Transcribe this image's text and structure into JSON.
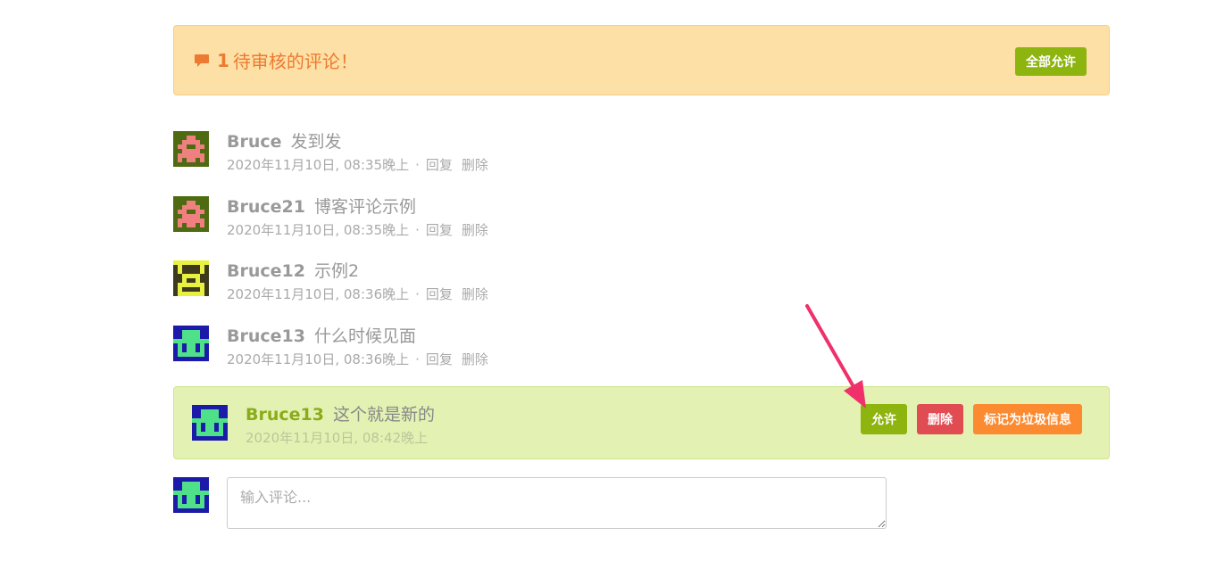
{
  "pending": {
    "count": "1",
    "title": "待审核的评论！",
    "approve_all_label": "全部允许"
  },
  "comments": [
    {
      "author": "Bruce",
      "text": "发到发",
      "date": "2020年11月10日, 08:35晚上",
      "sep": "·",
      "reply": "回复",
      "delete": "删除"
    },
    {
      "author": "Bruce21",
      "text": "博客评论示例",
      "date": "2020年11月10日, 08:35晚上",
      "sep": "·",
      "reply": "回复",
      "delete": "删除"
    },
    {
      "author": "Bruce12",
      "text": "示例2",
      "date": "2020年11月10日, 08:36晚上",
      "sep": "·",
      "reply": "回复",
      "delete": "删除"
    },
    {
      "author": "Bruce13",
      "text": "什么时候见面",
      "date": "2020年11月10日, 08:36晚上",
      "sep": "·",
      "reply": "回复",
      "delete": "删除"
    }
  ],
  "new_comment": {
    "author": "Bruce13",
    "text": "这个就是新的",
    "date": "2020年11月10日, 08:42晚上",
    "allow_label": "允许",
    "delete_label": "删除",
    "spam_label": "标记为垃圾信息"
  },
  "reply": {
    "placeholder": "输入评论..."
  },
  "colors": {
    "banner_bg": "#fde0a6",
    "banner_text": "#ec7a30",
    "approve_green": "#8db40f",
    "delete_red": "#e14c52",
    "spam_orange": "#fb8a31",
    "new_comment_bg": "#e3f2b3",
    "arrow_pink": "#f0306a"
  },
  "icons": {
    "banner": "comment-icon",
    "avatars": [
      "identicon-pink-on-olive",
      "identicon-pink-on-olive",
      "identicon-yellow-on-dark",
      "identicon-green-on-blue"
    ]
  }
}
